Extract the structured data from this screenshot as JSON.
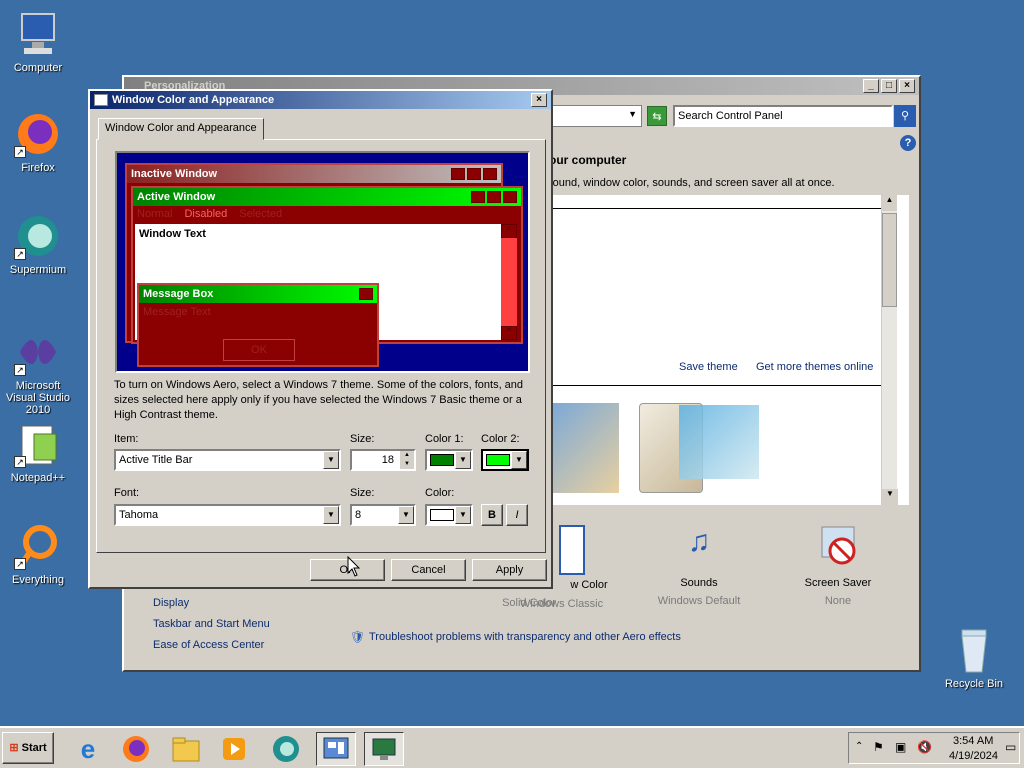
{
  "desktop": {
    "icons": [
      {
        "label": "Computer"
      },
      {
        "label": "Firefox"
      },
      {
        "label": "Supermium"
      },
      {
        "label": "Microsoft Visual Studio 2010"
      },
      {
        "label": "Notepad++"
      },
      {
        "label": "Everything"
      },
      {
        "label": "Recycle Bin"
      }
    ]
  },
  "personalization": {
    "title": "Personalization",
    "search_placeholder": "Search Control Panel",
    "heading": "our computer",
    "subheading": "round, window color, sounds, and screen saver all at once.",
    "save_theme": "Save theme",
    "more_themes": "Get more themes online",
    "sidebar": [
      "Display",
      "Taskbar and Start Menu",
      "Ease of Access Center"
    ],
    "bottom_items": [
      {
        "label": "w Color",
        "sub": "Solid Color"
      },
      {
        "label": "",
        "sub": "Windows Classic"
      },
      {
        "label": "Sounds",
        "sub": "Windows Default"
      },
      {
        "label": "Screen Saver",
        "sub": "None"
      }
    ],
    "troubleshoot": "Troubleshoot problems with transparency and other Aero effects"
  },
  "dialog": {
    "title": "Window Color and Appearance",
    "tab": "Window Color and Appearance",
    "preview": {
      "inactive_title": "Inactive Window",
      "active_title": "Active Window",
      "menu": [
        "Normal",
        "Disabled",
        "Selected"
      ],
      "window_text": "Window Text",
      "msgbox_title": "Message Box",
      "msgbox_text": "Message Text",
      "ok": "OK"
    },
    "info": "To turn on Windows Aero, select a Windows 7 theme.  Some of the colors, fonts, and sizes selected here apply only if you have selected the Windows 7 Basic theme or a High Contrast theme.",
    "item_label": "Item:",
    "item_value": "Active Title Bar",
    "size_label": "Size:",
    "size_value": "18",
    "color1_label": "Color 1:",
    "color2_label": "Color 2:",
    "color1": "#008000",
    "color2": "#00ff00",
    "font_label": "Font:",
    "font_value": "Tahoma",
    "font_size_label": "Size:",
    "font_size_value": "8",
    "font_color_label": "Color:",
    "font_color": "#ffffff",
    "bold": "B",
    "italic": "I",
    "ok": "OK",
    "cancel": "Cancel",
    "apply": "Apply"
  },
  "taskbar": {
    "start": "Start",
    "time": "3:54 AM",
    "date": "4/19/2024"
  }
}
